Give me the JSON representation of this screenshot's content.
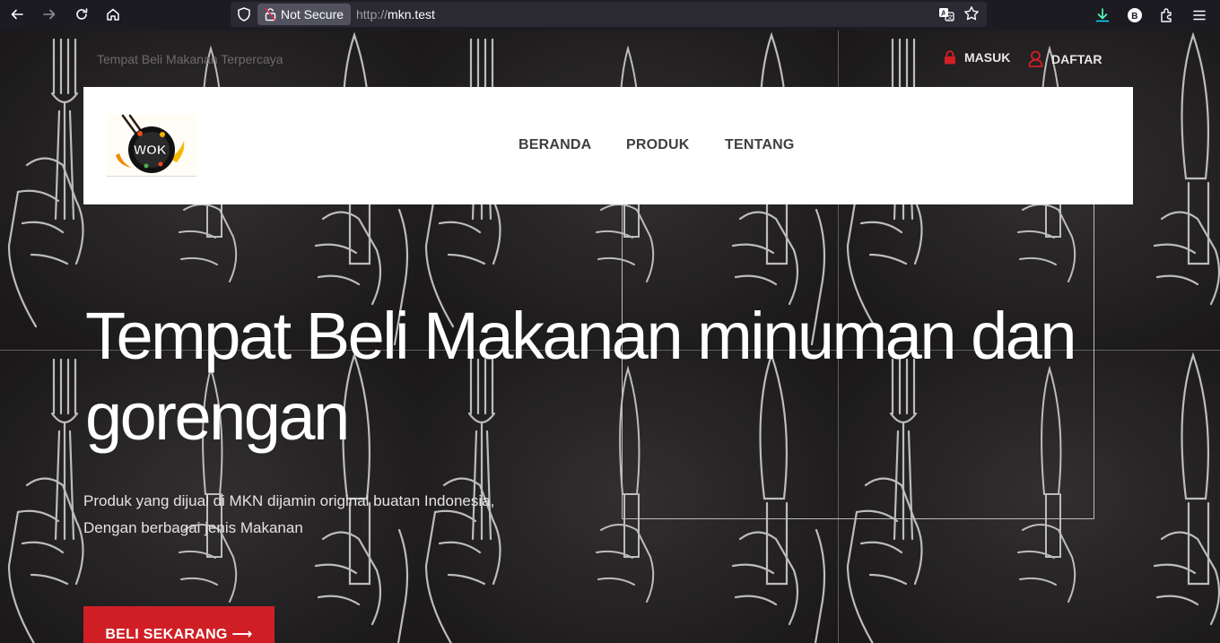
{
  "browser": {
    "security_label": "Not Secure",
    "url_scheme": "http://",
    "url_host": "mkn.test",
    "profile_initial": "B"
  },
  "header": {
    "tagline": "Tempat Beli Makanan Terpercaya",
    "login_label": "MASUK",
    "register_label": "DAFTAR"
  },
  "nav": {
    "logo_text": "WOK",
    "items": [
      {
        "label": "BERANDA"
      },
      {
        "label": "PRODUK"
      },
      {
        "label": "TENTANG"
      }
    ]
  },
  "hero": {
    "title_line1": "Tempat Beli Makanan minuman dan",
    "title_line2": "gorengan",
    "subtitle_line1": "Produk yang dijual di MKN dijamin original buatan Indonesia,",
    "subtitle_line2": "Dengan berbagai jenis Makanan",
    "cta_label": "BELI SEKARANG ⟶"
  },
  "colors": {
    "accent_red": "#cf1f25",
    "nav_text": "#3f3f3f",
    "browser_bg": "#1c1b22"
  },
  "icons": [
    "back-icon",
    "forward-icon",
    "reload-icon",
    "home-icon",
    "shield-icon",
    "lock-icon",
    "translate-icon",
    "bookmark-star-icon",
    "download-icon",
    "profile-icon",
    "extensions-icon",
    "menu-icon"
  ]
}
